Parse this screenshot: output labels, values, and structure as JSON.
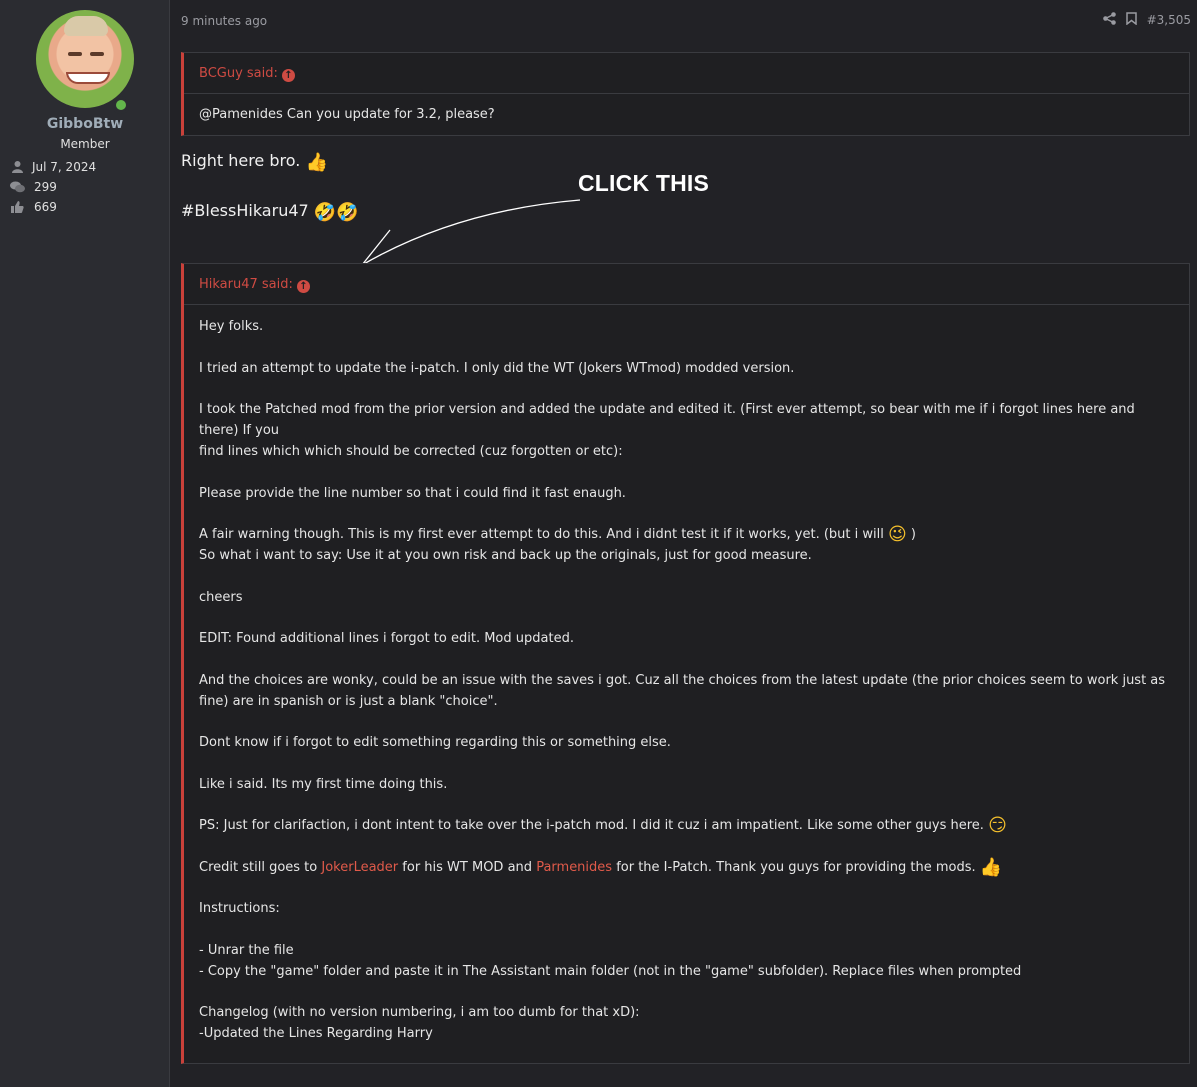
{
  "sidebar": {
    "username": "GibboBtw",
    "user_title": "Member",
    "stats": [
      {
        "icon": "user-icon",
        "value": "Jul 7, 2024"
      },
      {
        "icon": "messages-icon",
        "value": "299"
      },
      {
        "icon": "thumbs-up-icon",
        "value": "669"
      }
    ]
  },
  "post": {
    "time": "9 minutes ago",
    "number": "#3,505",
    "quote1": {
      "author": "BCGuy said:",
      "text": "@Pamenides Can you update for 3.2, please?"
    },
    "message": {
      "line1": "Right here bro.",
      "line2": "#BlessHikaru47"
    },
    "quote2": {
      "author": "Hikaru47 said:",
      "p1": "Hey folks.",
      "p2": "I tried an attempt to update the i-patch. I only did the WT (Jokers WTmod) modded version.",
      "p3a": "I took the Patched mod from the prior version and added the update and edited it. (First ever attempt, so bear with me if i forgot lines here and there) If you",
      "p3b": "find lines which which should be corrected (cuz forgotten or etc):",
      "p4": "Please provide the line number so that i could find it fast enaugh.",
      "p5a": "A fair warning though. This is my first ever attempt to do this. And i didnt test it if it works, yet. (but i will",
      "p5a_end": ")",
      "p5b": "So what i want to say: Use it at you own risk and back up the originals, just for good measure.",
      "p6": "cheers",
      "p7": "EDIT: Found additional lines i forgot to edit. Mod updated.",
      "p8": "And the choices are wonky, could be an issue with the saves i got. Cuz all the choices from the latest update (the prior choices seem to work just as fine) are in spanish or is just a blank \"choice\".",
      "p9": "Dont know if i forgot to edit something regarding this or something else.",
      "p10": "Like i said. Its my first time doing this.",
      "p11": "PS: Just for clarifaction, i dont intent to take over the i-patch mod. I did it cuz i am impatient. Like some other guys here.",
      "p12_pre": "Credit still goes to",
      "p12_link1": "JokerLeader",
      "p12_mid": "for his WT MOD and",
      "p12_link2": "Parmenides",
      "p12_post": "for the I-Patch. Thank you guys for providing the mods.",
      "p13": "Instructions:",
      "p14a": "- Unrar the file",
      "p14b": "- Copy the \"game\" folder and paste it in The Assistant main folder (not in the \"game\" subfolder). Replace files when prompted",
      "p15a": "Changelog (with no version numbering, i am too dumb for that xD):",
      "p15b": "-Updated the Lines Regarding Harry"
    }
  },
  "annotation": {
    "text": "CLICK THIS"
  },
  "colors": {
    "accent": "#c9413a",
    "link": "#e05a4a",
    "username": "#a0adb8",
    "online": "#63b64b"
  }
}
